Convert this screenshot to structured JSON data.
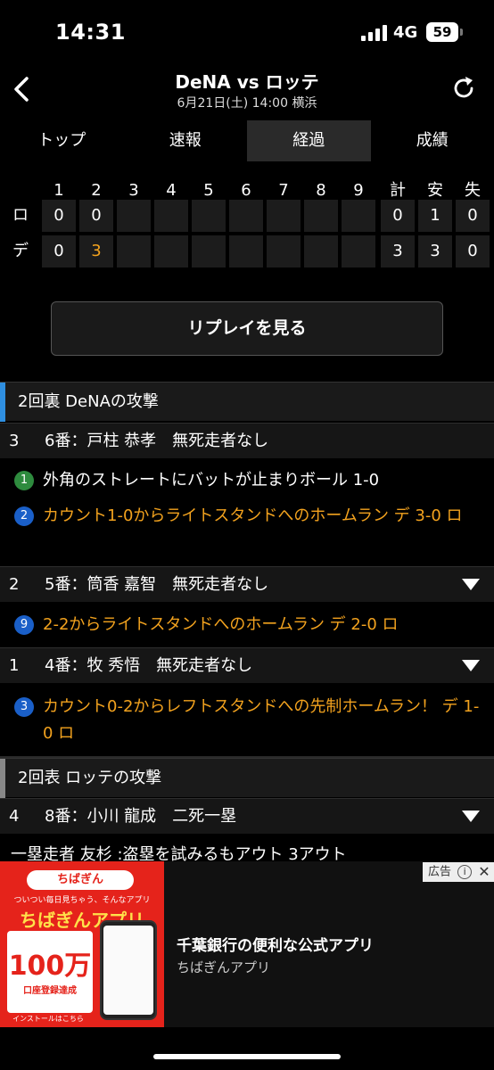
{
  "status": {
    "time": "14:31",
    "network": "4G",
    "battery": "59"
  },
  "header": {
    "title": "DeNA vs ロッテ",
    "subtitle": "6月21日(土) 14:00 横浜"
  },
  "tabs": [
    {
      "label": "トップ",
      "active": false
    },
    {
      "label": "速報",
      "active": false
    },
    {
      "label": "経過",
      "active": true
    },
    {
      "label": "成績",
      "active": false
    }
  ],
  "scoreboard": {
    "headers": [
      "1",
      "2",
      "3",
      "4",
      "5",
      "6",
      "7",
      "8",
      "9",
      "計",
      "安",
      "失"
    ],
    "rows": [
      {
        "team": "ロ",
        "innings": [
          "0",
          "0",
          "",
          "",
          "",
          "",
          "",
          "",
          ""
        ],
        "totals": [
          "0",
          "1",
          "0"
        ]
      },
      {
        "team": "デ",
        "innings": [
          "0",
          "3",
          "",
          "",
          "",
          "",
          "",
          "",
          ""
        ],
        "totals": [
          "3",
          "3",
          "0"
        ]
      }
    ],
    "highlight_color": "#f2a21e"
  },
  "replay_label": "リプレイを見る",
  "feed": {
    "inning1": {
      "title": "2回裏 DeNAの攻撃",
      "accent": "#2f8fe0"
    },
    "batters": [
      {
        "order": "3",
        "text": "6番：戸柱 恭孝　無死走者なし"
      },
      {
        "order": "2",
        "text": "5番：筒香 嘉智　無死走者なし"
      },
      {
        "order": "1",
        "text": "4番：牧 秀悟　無死走者なし"
      },
      {
        "order": "4",
        "text": "8番：小川 龍成　二死一塁"
      }
    ],
    "plays": [
      {
        "badge": "1",
        "text": "外角のストレートにバットが止まりボール 1-0"
      },
      {
        "badge": "2",
        "text": "カウント1-0からライトスタンドへのホームラン デ 3-0 ロ"
      },
      {
        "badge": "9",
        "text": "2-2からライトスタンドへのホームラン デ 2-0 ロ"
      },
      {
        "badge": "3",
        "text": "カウント0-2からレフトスタンドへの先制ホームラン！ デ 1-0 ロ"
      }
    ],
    "inning2": {
      "title": "2回表 ロッテの攻撃",
      "accent": "#888888"
    },
    "cut_text": "一塁走者 友杉 :盗塁を試みるもアウト 3アウト"
  },
  "ad": {
    "label": "広告",
    "title": "千葉銀行の便利な公式アプリ",
    "subtitle": "ちばぎんアプリ",
    "banner_logo": "ちばぎん",
    "banner_tagline": "ついつい毎日見ちゃう、そんなアプリ",
    "banner_app": "ちばぎんアプリ",
    "banner_big": "100万",
    "banner_sub": "口座登録達成",
    "banner_install": "インストールはこちら"
  }
}
